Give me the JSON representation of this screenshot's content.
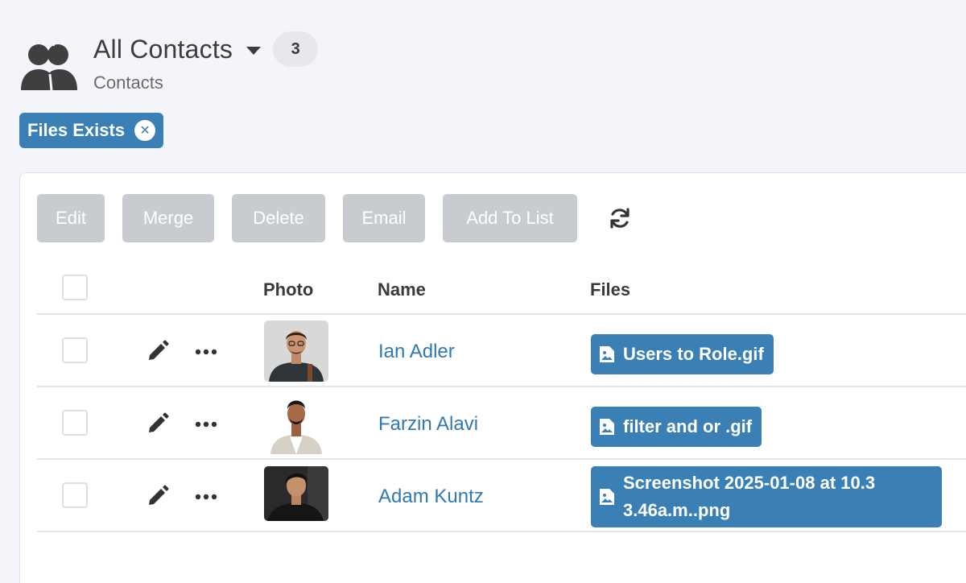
{
  "header": {
    "icon": "users-icon",
    "title": "All Contacts",
    "count": "3",
    "subtitle": "Contacts"
  },
  "filter": {
    "label": "Files Exists",
    "close_icon": "close-icon"
  },
  "toolbar": {
    "buttons": [
      "Edit",
      "Merge",
      "Delete",
      "Email",
      "Add To List"
    ],
    "refresh_icon": "refresh-icon"
  },
  "table": {
    "columns": {
      "photo": "Photo",
      "name": "Name",
      "files": "Files"
    },
    "rows": [
      {
        "name": "Ian Adler",
        "file": "Users to Role.gif"
      },
      {
        "name": "Farzin Alavi",
        "file": "filter and or .gif"
      },
      {
        "name": "Adam Kuntz",
        "file_line1": "Screenshot 2025-01-08 at 10.3",
        "file_line2": "3.46a.m..png"
      }
    ]
  },
  "colors": {
    "accent": "#3a80b4",
    "link": "#2f7ab0",
    "disabled_button": "#c8cbcf",
    "background": "#f3f5fa"
  }
}
